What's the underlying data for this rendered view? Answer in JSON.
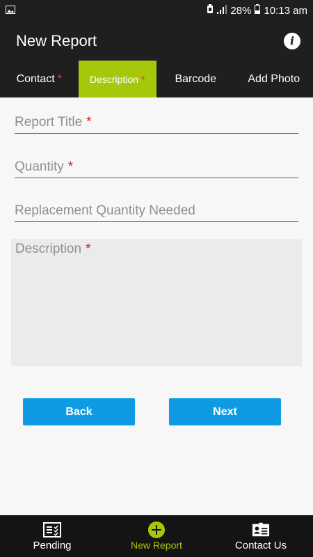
{
  "status_bar": {
    "battery": "28%",
    "time": "10:13 am",
    "icons": [
      "image-notification-icon",
      "alarm-icon",
      "signal-icon",
      "battery-icon"
    ]
  },
  "app_bar": {
    "title": "New Report",
    "info_icon": "info-icon"
  },
  "tabs": [
    {
      "label": "Contact",
      "required": "*",
      "active": false
    },
    {
      "label": "Description",
      "required": "*",
      "active": true
    },
    {
      "label": "Barcode",
      "required": "",
      "active": false
    },
    {
      "label": "Add Photo",
      "required": "",
      "active": false
    }
  ],
  "form": {
    "report_title": {
      "placeholder": "Report Title",
      "required": "*",
      "value": ""
    },
    "quantity": {
      "placeholder": "Quantity",
      "required": "*",
      "value": ""
    },
    "replacement_quantity": {
      "placeholder": "Replacement Quantity Needed",
      "value": ""
    },
    "description": {
      "placeholder": "Description",
      "required": "*",
      "value": ""
    }
  },
  "buttons": {
    "back": "Back",
    "next": "Next"
  },
  "bottom_nav": [
    {
      "label": "Pending",
      "icon": "checklist-icon",
      "active": false
    },
    {
      "label": "New Report",
      "icon": "add-circle-icon",
      "active": true
    },
    {
      "label": "Contact Us",
      "icon": "contact-card-icon",
      "active": false
    }
  ],
  "colors": {
    "bar_background": "#1f1f1f",
    "accent": "#a6c80a",
    "button": "#0f9be3",
    "required": "#d61a1a"
  }
}
